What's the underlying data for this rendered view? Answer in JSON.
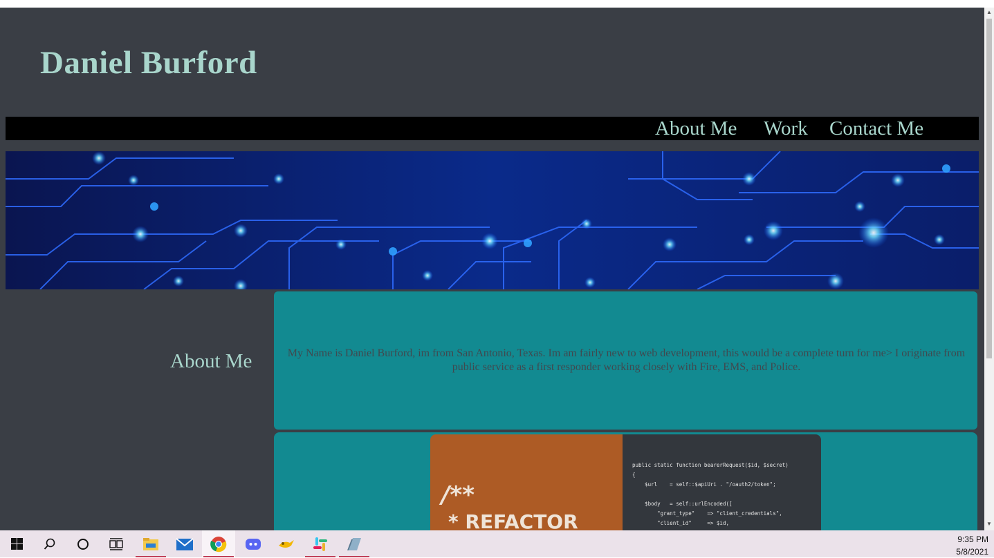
{
  "site": {
    "title": "Daniel Burford"
  },
  "nav": {
    "items": [
      {
        "label": "About Me"
      },
      {
        "label": "Work"
      },
      {
        "label": "Contact Me"
      }
    ]
  },
  "about": {
    "heading": "About Me",
    "text": "My Name is Daniel Burford, im from San Antonio, Texas. Im am fairly new to web development, this would be a complete turn for me> I originate from public service as a first responder working closely with Fire, EMS, and Police."
  },
  "work": {
    "image_comment": "/**",
    "image_refactor": "* REFACTOR",
    "image_code": "public static function bearerRequest($id, $secret)\n{\n    $url    = self::$apiUri . \"/oauth2/token\";\n\n    $body   = self::urlEncoded([\n        \"grant_type\"    => \"client_credentials\",\n        \"client_id\"     => $id,"
  },
  "taskbar": {
    "icons": [
      "windows-start-icon",
      "search-icon",
      "cortana-icon",
      "task-view-icon",
      "file-explorer-icon",
      "mail-icon",
      "chrome-icon",
      "discord-icon",
      "genie-icon",
      "slack-icon",
      "notes-icon"
    ],
    "time": "9:35 PM",
    "date": "5/8/2021"
  },
  "colors": {
    "accent": "#a9d6cc",
    "page_bg": "#3a3e45",
    "card_bg": "#128a91",
    "nav_bg": "#000000"
  }
}
